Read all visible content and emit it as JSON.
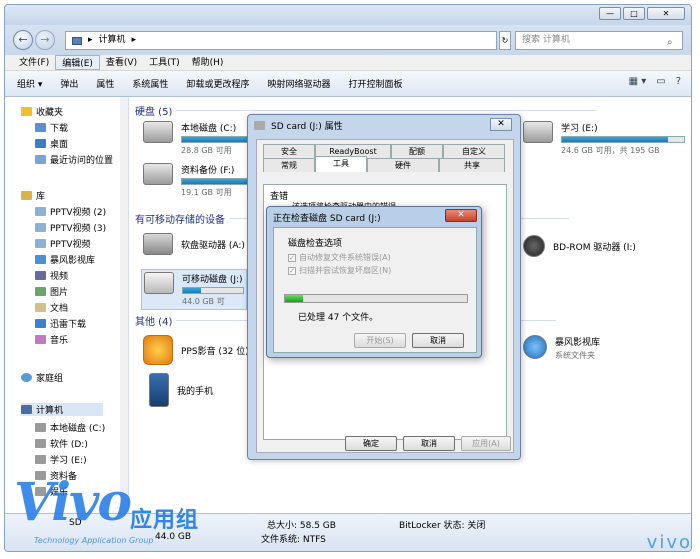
{
  "window": {
    "caption_min": "—",
    "caption_max": "□",
    "caption_close": "✕"
  },
  "nav": {
    "back": "←",
    "forward": "→",
    "address_arrow": "▸",
    "address_item": "计算机",
    "address_arrow2": "▸",
    "go_icon": "↻",
    "search_placeholder": "搜索 计算机",
    "search_icon": "⌕"
  },
  "menu": [
    "文件(F)",
    "编辑(E)",
    "查看(V)",
    "工具(T)",
    "帮助(H)"
  ],
  "toolbar": {
    "items": [
      "组织 ▾",
      "弹出",
      "属性",
      "系统属性",
      "卸载或更改程序",
      "映射网络驱动器",
      "打开控制面板"
    ],
    "right_icons": [
      "▦ ▾",
      "▭",
      "?"
    ]
  },
  "sidebar": {
    "favorites": "收藏夹",
    "fav_items": [
      "下载",
      "桌面",
      "最近访问的位置"
    ],
    "library": "库",
    "lib_items": [
      "PPTV视频 (2)",
      "PPTV视频 (3)",
      "PPTV视频",
      "暴风影视库",
      "视频",
      "图片",
      "文档",
      "迅雷下载",
      "音乐"
    ],
    "homegroup": "家庭组",
    "computer": "计算机",
    "comp_items": [
      "本地磁盘 (C:)",
      "软件 (D:)",
      "学习 (E:)",
      "资料备",
      "娱乐"
    ]
  },
  "content": {
    "hdd_group": "硬盘 (5)",
    "removable_group": "有可移动存储的设备",
    "other_group": "其他 (4)",
    "drive_c": {
      "name": "本地磁盘 (C:)",
      "free": "28.8 GB 可用",
      "used_fraction": 0.75
    },
    "drive_f": {
      "name": "资料备份 (F:)",
      "free": "19.1 GB 可用",
      "used_fraction": 0.6
    },
    "drive_e": {
      "name": "学习 (E:)",
      "free": "24.6 GB 可用，共 195 GB",
      "used_fraction": 0.87
    },
    "drive_a": {
      "name": "软盘驱动器 (A:)"
    },
    "drive_j": {
      "name": "可移动磁盘 (J:)",
      "free": "44.0 GB 可",
      "used_fraction": 0.3
    },
    "drive_i": {
      "name": "BD-ROM 驱动器 (I:)"
    },
    "pps": "PPS影音 (32 位)",
    "phone": "我的手机",
    "baofeng": "暴风影视库",
    "baofeng_sub": "系统文件夹"
  },
  "status": {
    "drive_label": "SD",
    "free_value": "44.0 GB",
    "total_label": "总大小: 58.5 GB",
    "fs_label": "文件系统: NTFS",
    "bitlocker": "BitLocker 状态: 关闭"
  },
  "props_dialog": {
    "title": "SD card (J:) 属性",
    "close": "✕",
    "tabs_top": [
      "安全",
      "ReadyBoost",
      "配额",
      "自定义"
    ],
    "tabs_bottom": [
      "常规",
      "工具",
      "硬件",
      "共享"
    ],
    "section": "查错",
    "desc": "该选项将检查驱动器中的错误。",
    "btn_ok": "确定",
    "btn_cancel": "取消",
    "btn_apply": "应用(A)"
  },
  "check_dialog": {
    "title": "正在检查磁盘 SD card (J:)",
    "close": "✕",
    "options_label": "磁盘检查选项",
    "opt1": "自动修复文件系统错误(A)",
    "opt2": "扫描并尝试恢复坏扇区(N)",
    "check_mark": "✓",
    "progress": 0.1,
    "processed": "已处理 47 个文件。",
    "btn_start": "开始(S)",
    "btn_cancel": "取消"
  },
  "watermark": {
    "big": "Vivo",
    "cn": "应用组",
    "en": "Technology Application Group"
  },
  "brand": "vivo"
}
